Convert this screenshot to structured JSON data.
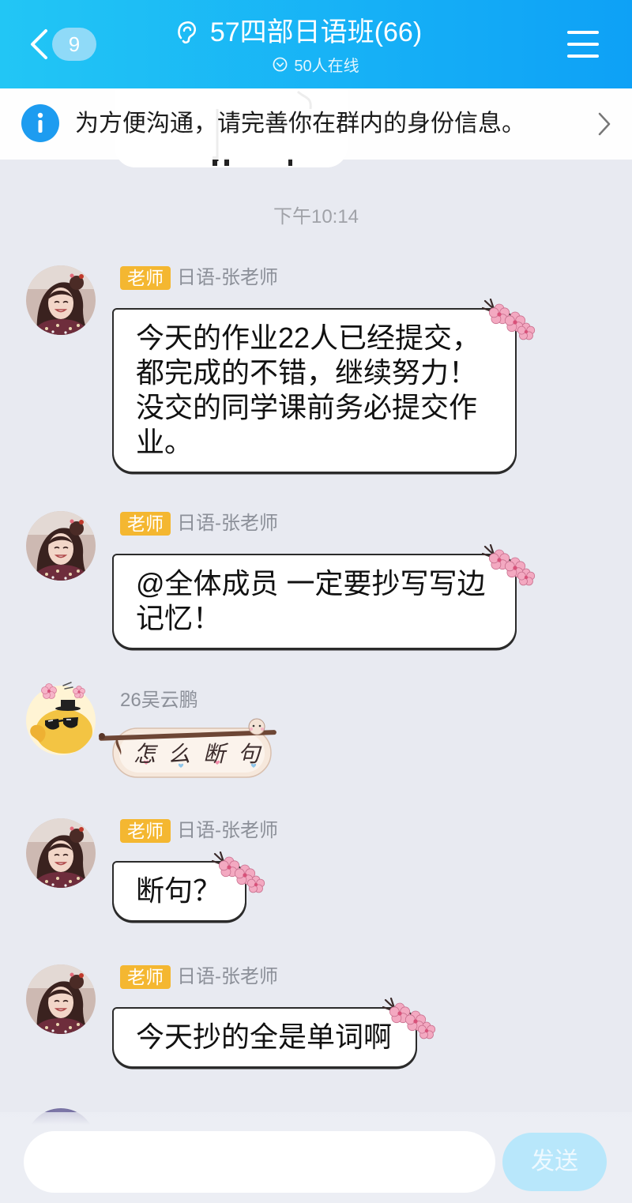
{
  "colors": {
    "header_gradient_start": "#22c6f5",
    "header_gradient_end": "#0ea1f6",
    "chat_background": "#e8eaf1",
    "teacher_tag": "#f4b731",
    "info_icon": "#1d9cf0",
    "send_button": "#b8e7fb"
  },
  "header": {
    "back_icon": "chevron-left-icon",
    "unread_badge": "9",
    "ear_icon": "ear-icon",
    "title": "57四部日语班(66)",
    "online_icon": "circle-chevron-down-icon",
    "online_status": "50人在线",
    "menu_icon": "hamburger-menu-icon"
  },
  "notice": {
    "icon": "info-icon",
    "text": "为方便沟通，请完善你在群内的身份信息。",
    "chevron_icon": "chevron-right-icon"
  },
  "timestamp": "下午10:14",
  "messages": [
    {
      "tag": "老师",
      "sender": "日语-张老师",
      "lines": [
        "今天的作业22人已经提交，",
        "都完成的不错，继续努力！",
        "没交的同学课前务必提交作",
        "业。"
      ]
    },
    {
      "tag": "老师",
      "sender": "日语-张老师",
      "lines": [
        "@全体成员 一定要抄写写边",
        "记忆！"
      ]
    },
    {
      "sender": "26吴云鹏",
      "sticker_text": "怎么断句"
    },
    {
      "tag": "老师",
      "sender": "日语-张老师",
      "lines": [
        "断句？"
      ]
    },
    {
      "tag": "老师",
      "sender": "日语-张老师",
      "lines": [
        "今天抄的全是单词啊"
      ]
    }
  ],
  "composer": {
    "input_value": "",
    "send_label": "发送"
  }
}
